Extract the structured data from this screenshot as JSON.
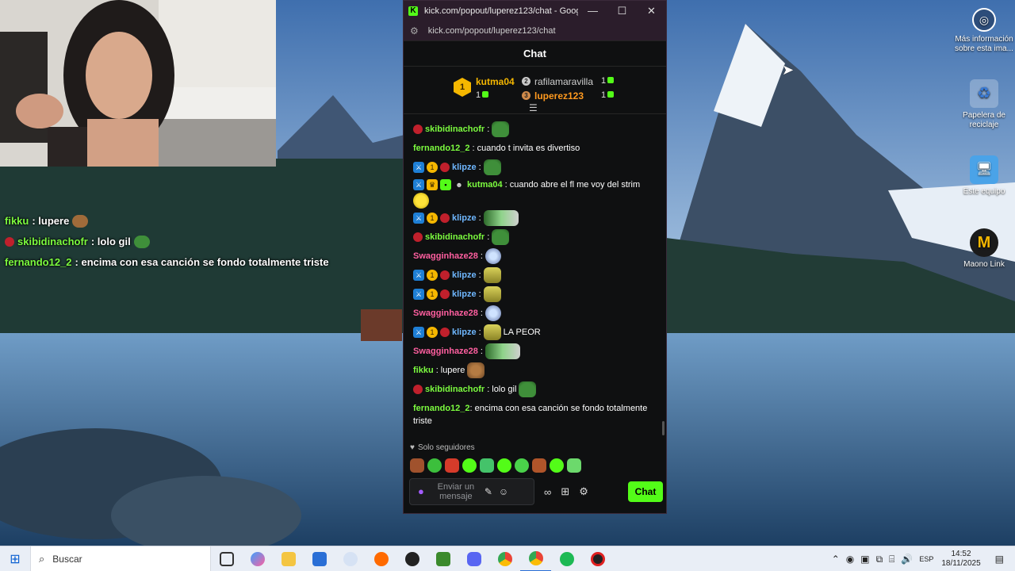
{
  "window": {
    "title": "kick.com/popout/luperez123/chat - Google C...",
    "url": "kick.com/popout/luperez123/chat",
    "minimize": "—",
    "maximize": "☐",
    "close": "✕"
  },
  "chat": {
    "header": "Chat",
    "leaderboard": {
      "first": {
        "rank": "1",
        "name": "kutma04",
        "count": "1"
      },
      "second": {
        "rank": "2",
        "name": "rafilamaravilla",
        "count": "1"
      },
      "third": {
        "rank": "3",
        "name": "luperez123",
        "count": "1"
      }
    },
    "messages": [
      {
        "user": "skibidinachofr",
        "text": ""
      },
      {
        "user": "fernando12_2",
        "text": "cuando t invita es divertiso"
      },
      {
        "user": "klipze",
        "text": ""
      },
      {
        "user": "kutma04",
        "text": "cuando abre el fl me voy del strim"
      },
      {
        "user": "klipze",
        "text": ""
      },
      {
        "user": "skibidinachofr",
        "text": ""
      },
      {
        "user": "Swagginhaze28",
        "text": ""
      },
      {
        "user": "klipze",
        "text": ""
      },
      {
        "user": "klipze",
        "text": ""
      },
      {
        "user": "Swagginhaze28",
        "text": ""
      },
      {
        "user": "klipze",
        "text": "LA PEOR"
      },
      {
        "user": "Swagginhaze28",
        "text": ""
      },
      {
        "user": "fikku",
        "text": "lupere"
      },
      {
        "user": "skibidinachofr",
        "text": "lolo gil"
      },
      {
        "user": "fernando12_2",
        "text": "encima con esa canción se fondo totalmente triste"
      }
    ],
    "followers_only": "Solo seguidores",
    "input_placeholder": "Enviar un mensaje",
    "send_label": "Chat"
  },
  "overlay_chat": [
    {
      "user": "fikku",
      "text": ": lupere"
    },
    {
      "user": "skibidinachofr",
      "text": ": lolo gil"
    },
    {
      "user": "fernando12_2",
      "text": ": encima con esa canción se fondo totalmente triste"
    }
  ],
  "desktop_icons": [
    {
      "label": "Más información sobre esta ima...",
      "icon": "camera-icon"
    },
    {
      "label": "Papelera de reciclaje",
      "icon": "recycle-bin-icon"
    },
    {
      "label": "Este equipo",
      "icon": "computer-icon"
    },
    {
      "label": "Maono Link",
      "icon": "maono-icon"
    }
  ],
  "taskbar": {
    "search_placeholder": "Buscar",
    "language": "ESP",
    "time": "14:52",
    "date": "18/11/2025"
  },
  "colors": {
    "kick_green": "#53fc18",
    "user_green": "#7cfc3f",
    "user_blue": "#6fb7ff",
    "user_pink": "#ff5fa0",
    "user_orange": "#ff9a1f"
  }
}
